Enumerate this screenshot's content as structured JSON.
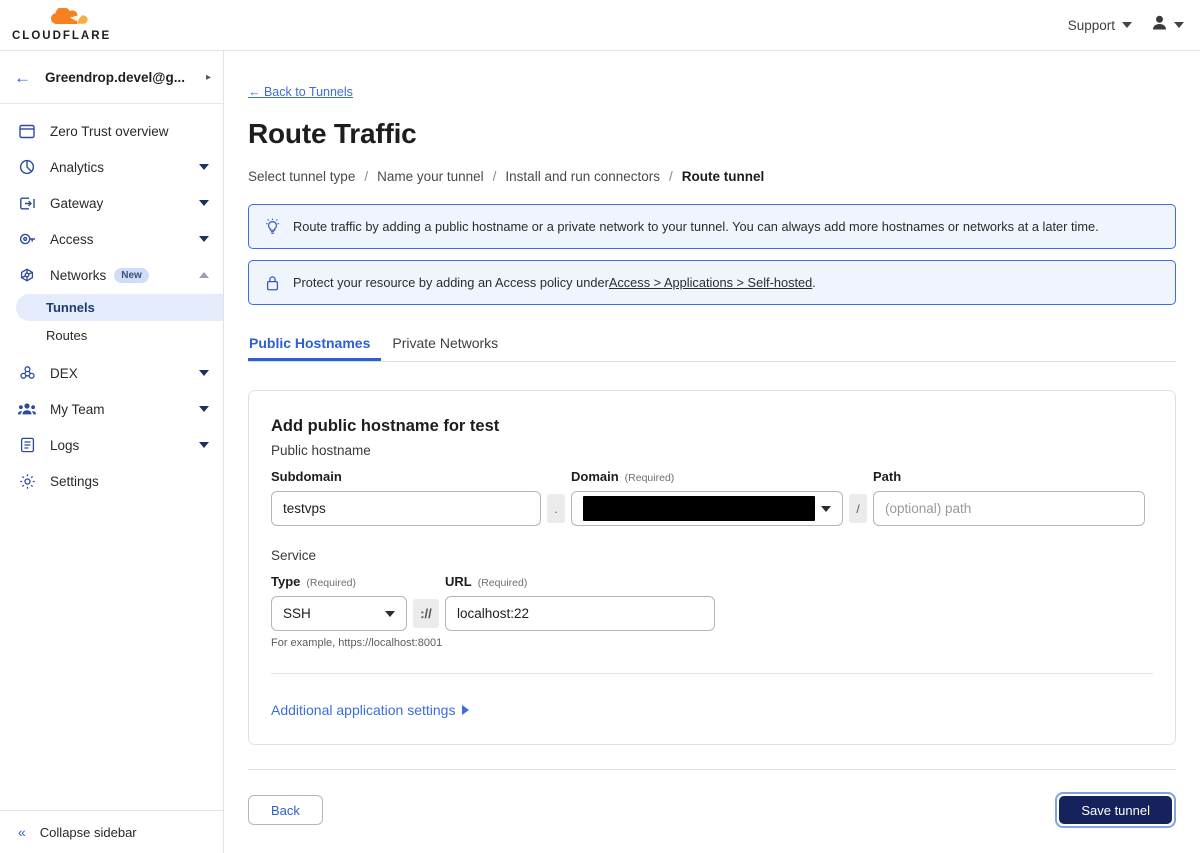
{
  "topbar": {
    "logo_text": "CLOUDFLARE",
    "logo_icon": "cloudflare-cloud-icon",
    "support_label": "Support",
    "support_caret_icon": "chevron-down-icon",
    "user_icon": "user-avatar-icon",
    "user_caret_icon": "chevron-down-icon"
  },
  "sidebar": {
    "account": {
      "back_icon": "arrow-left-icon",
      "name": "Greendrop.devel@g...",
      "caret_icon": "chevron-right-icon"
    },
    "items": [
      {
        "label": "Zero Trust overview",
        "icon": "window-icon",
        "expandable": false
      },
      {
        "label": "Analytics",
        "icon": "pie-chart-icon",
        "expandable": true
      },
      {
        "label": "Gateway",
        "icon": "gateway-arrow-icon",
        "expandable": true
      },
      {
        "label": "Access",
        "icon": "access-key-icon",
        "expandable": true
      },
      {
        "label": "Networks",
        "icon": "network-nodes-icon",
        "expandable": true,
        "badge": "New",
        "expanded": true
      }
    ],
    "networks_children": [
      {
        "label": "Tunnels",
        "active": true
      },
      {
        "label": "Routes",
        "active": false
      }
    ],
    "items_after": [
      {
        "label": "DEX",
        "icon": "dex-molecule-icon",
        "expandable": true
      },
      {
        "label": "My Team",
        "icon": "team-people-icon",
        "expandable": true
      },
      {
        "label": "Logs",
        "icon": "logs-list-icon",
        "expandable": true
      },
      {
        "label": "Settings",
        "icon": "gear-icon",
        "expandable": false
      }
    ],
    "collapse": {
      "label": "Collapse sidebar",
      "icon": "chevrons-left-icon"
    }
  },
  "main": {
    "back_link": "← Back to Tunnels",
    "page_title": "Route Traffic",
    "breadcrumb": [
      {
        "label": "Select tunnel type",
        "current": false
      },
      {
        "label": "Name your tunnel",
        "current": false
      },
      {
        "label": "Install and run connectors",
        "current": false
      },
      {
        "label": "Route tunnel",
        "current": true
      }
    ],
    "breadcrumb_separator": "/",
    "banners": [
      {
        "icon": "lightbulb-icon",
        "text": "Route traffic by adding a public hostname or a private network to your tunnel. You can always add more hostnames or networks at a later time."
      },
      {
        "icon": "lock-icon",
        "text_before": "Protect your resource by adding an Access policy under ",
        "link": "Access > Applications > Self-hosted",
        "text_after": "."
      }
    ],
    "tabs": [
      {
        "label": "Public Hostnames",
        "active": true
      },
      {
        "label": "Private Networks",
        "active": false
      }
    ],
    "card": {
      "title": "Add public hostname for test",
      "public_hostname_label": "Public hostname",
      "subdomain": {
        "label": "Subdomain",
        "value": "testvps"
      },
      "dot_separator": ".",
      "domain": {
        "label": "Domain",
        "required": "(Required)",
        "value": "",
        "redacted": true,
        "caret_icon": "chevron-down-icon"
      },
      "slash_separator": "/",
      "path": {
        "label": "Path",
        "value": "",
        "placeholder": "(optional) path"
      },
      "service_label": "Service",
      "type": {
        "label": "Type",
        "required": "(Required)",
        "value": "SSH",
        "caret_icon": "chevron-down-icon"
      },
      "protocol_separator": "://",
      "url": {
        "label": "URL",
        "required": "(Required)",
        "value": "localhost:22"
      },
      "url_hint": "For example, https://localhost:8001",
      "additional_settings": {
        "label": "Additional application settings",
        "icon": "triangle-right-icon"
      }
    },
    "footer": {
      "back_label": "Back",
      "save_label": "Save tunnel"
    }
  },
  "colors": {
    "brand_orange": "#f6821f",
    "link_blue": "#3b6ddb",
    "accent_blue": "#2c5fd3",
    "primary_navy": "#16225c",
    "banner_bg": "#eff4fd",
    "active_nav_bg": "#e4ecfb"
  }
}
